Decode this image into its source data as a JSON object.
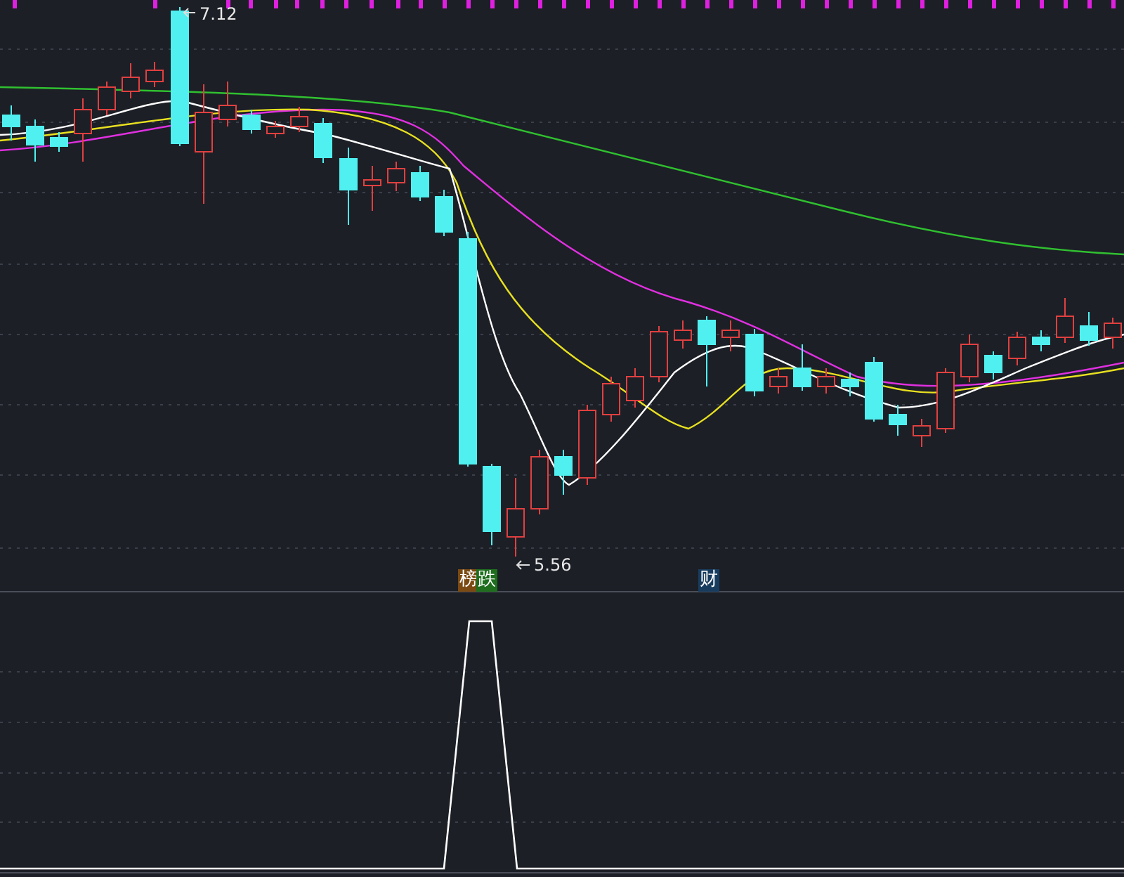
{
  "price_chart": {
    "high_label": "7.12",
    "low_label": "5.56",
    "tags": [
      {
        "text": "榜",
        "color": "#7a4a12"
      },
      {
        "text": "跌",
        "color": "#1e6e1e"
      },
      {
        "text": "财",
        "color": "#183c5e"
      }
    ]
  }
}
